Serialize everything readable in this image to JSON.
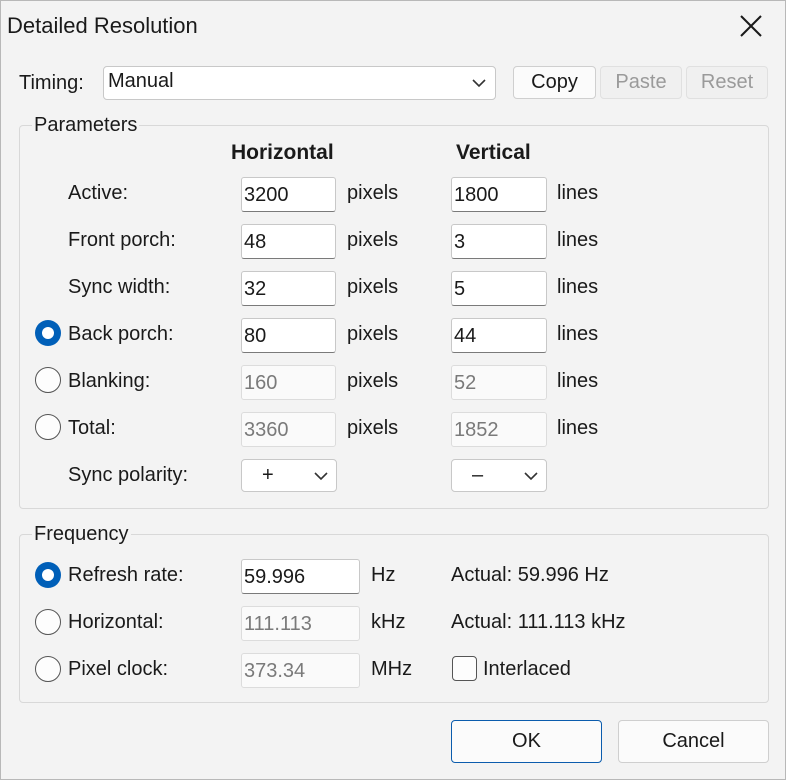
{
  "window": {
    "title": "Detailed Resolution"
  },
  "timing": {
    "label": "Timing:",
    "value": "Manual"
  },
  "toolbar": {
    "copy": "Copy",
    "paste": "Paste",
    "reset": "Reset"
  },
  "parameters": {
    "title": "Parameters",
    "col_horizontal": "Horizontal",
    "col_vertical": "Vertical",
    "unit_h": "pixels",
    "unit_v": "lines",
    "rows": [
      {
        "label": "Active:",
        "h": "3200",
        "v": "1800"
      },
      {
        "label": "Front porch:",
        "h": "48",
        "v": "3"
      },
      {
        "label": "Sync width:",
        "h": "32",
        "v": "5"
      },
      {
        "label": "Back porch:",
        "h": "80",
        "v": "44"
      },
      {
        "label": "Blanking:",
        "h": "160",
        "v": "52"
      },
      {
        "label": "Total:",
        "h": "3360",
        "v": "1852"
      }
    ],
    "sync_polarity": {
      "label": "Sync polarity:",
      "h": "+",
      "v": "–"
    }
  },
  "frequency": {
    "title": "Frequency",
    "refresh": {
      "label": "Refresh rate:",
      "value": "59.996",
      "unit": "Hz",
      "actual": "Actual: 59.996 Hz"
    },
    "horizontal": {
      "label": "Horizontal:",
      "value": "111.113",
      "unit": "kHz",
      "actual": "Actual: 111.113 kHz"
    },
    "pixel_clock": {
      "label": "Pixel clock:",
      "value": "373.34",
      "unit": "MHz"
    },
    "interlaced": "Interlaced"
  },
  "footer": {
    "ok": "OK",
    "cancel": "Cancel"
  },
  "colors": {
    "accent": "#005fb8",
    "window_bg": "#f3f3f3"
  }
}
